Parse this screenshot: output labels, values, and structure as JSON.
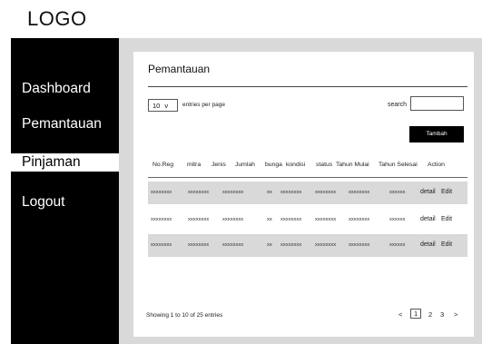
{
  "logo": "LOGO",
  "sidebar": {
    "items": [
      {
        "label": "Dashboard"
      },
      {
        "label": "Pemantauan"
      },
      {
        "label": "Pinjaman"
      },
      {
        "label": "Logout"
      }
    ],
    "active": "Pinjaman"
  },
  "main": {
    "title": "Pemantauan",
    "entries_select": {
      "value": "10",
      "arrow": "v"
    },
    "entries_label": "entries per page",
    "search_label": "search",
    "search_value": "",
    "add_button": "Tambah",
    "table": {
      "headers": [
        "No.Reg",
        "mitra",
        "Jenis",
        "Jumlah",
        "bunga",
        "kondisi",
        "status",
        "Tahun Mulai",
        "Tahun Selesai",
        "Action"
      ],
      "rows": [
        {
          "no_reg": "xxxxxxxx",
          "mitra": "xxxxxxxx",
          "jenis": "xxxxxxxx",
          "jumlah": "",
          "bunga": "xx",
          "kondisi": "xxxxxxxx",
          "status": "xxxxxxxx",
          "tahun_mulai": "xxxxxxxx",
          "tahun_selesai": "xxxxxx",
          "detail": "detail",
          "edit": "Edit"
        },
        {
          "no_reg": "xxxxxxxx",
          "mitra": "xxxxxxxx",
          "jenis": "xxxxxxxx",
          "jumlah": "",
          "bunga": "xx",
          "kondisi": "xxxxxxxx",
          "status": "xxxxxxxx",
          "tahun_mulai": "xxxxxxxx",
          "tahun_selesai": "xxxxxx",
          "detail": "detail",
          "edit": "Edit"
        },
        {
          "no_reg": "xxxxxxxx",
          "mitra": "xxxxxxxx",
          "jenis": "xxxxxxxx",
          "jumlah": "",
          "bunga": "xx",
          "kondisi": "xxxxxxxx",
          "status": "xxxxxxxx",
          "tahun_mulai": "xxxxxxxx",
          "tahun_selesai": "xxxxxx",
          "detail": "detail",
          "edit": "Edit"
        }
      ]
    },
    "footer_info": "Showing 1 to 10 of 25 entries",
    "pagination": {
      "prev": "<",
      "pages": [
        "1",
        "2",
        "3"
      ],
      "current": "1",
      "next": ">"
    }
  },
  "colors": {
    "sidebar_bg": "#000000",
    "content_bg": "#d9d9d9",
    "row_shade": "#d9d9d9",
    "button_bg": "#000000"
  }
}
